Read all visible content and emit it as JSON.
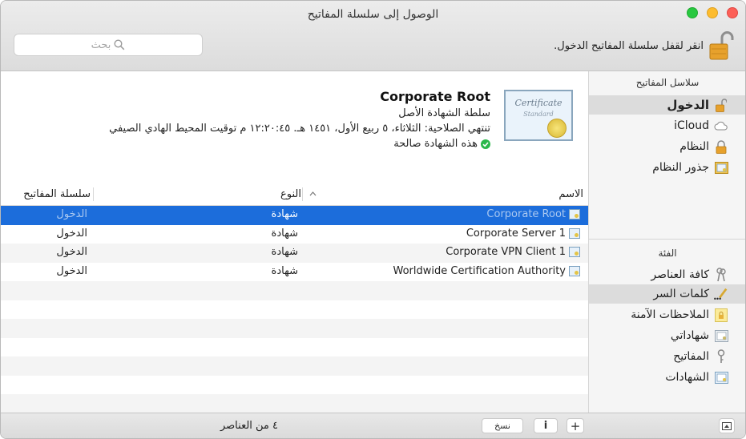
{
  "window": {
    "title": "الوصول إلى سلسلة المفاتيح"
  },
  "toolbar": {
    "search_placeholder": "بحث",
    "lock_text": "انقر لقفل سلسلة المفاتيح الدخول."
  },
  "sidebar": {
    "keychains_header": "سلاسل المفاتيح",
    "keychains": [
      {
        "label": "الدخول",
        "icon": "unlocked-padlock-icon",
        "selected": true
      },
      {
        "label": "iCloud",
        "icon": "cloud-icon"
      },
      {
        "label": "النظام",
        "icon": "locked-padlock-icon"
      },
      {
        "label": "جذور النظام",
        "icon": "certificate-folder-icon"
      }
    ],
    "category_header": "الفئة",
    "categories": [
      {
        "label": "كافة العناصر",
        "icon": "all-items-icon"
      },
      {
        "label": "كلمات السر",
        "icon": "pencil-dots-icon",
        "selected": true
      },
      {
        "label": "الملاحظات الآمنة",
        "icon": "secure-note-icon"
      },
      {
        "label": "شهاداتي",
        "icon": "my-certificate-icon"
      },
      {
        "label": "المفاتيح",
        "icon": "key-icon"
      },
      {
        "label": "الشهادات",
        "icon": "certificate-icon"
      }
    ]
  },
  "detail": {
    "name": "Corporate Root",
    "subtitle": "سلطة الشهادة الأصل",
    "expiry": "تنتهي الصلاحية: الثلاثاء، ٥ ربيع الأول، ١٤٥١ هـ. ١٢:٢٠:٤٥ م توقيت المحيط الهادي الصيفي",
    "status": "هذه الشهادة صالحة",
    "cert_title": "Certificate",
    "cert_sub": "Standard"
  },
  "table": {
    "headers": {
      "name": "الاسم",
      "kind": "النوع",
      "keychain": "سلسلة المفاتيح"
    },
    "rows": [
      {
        "name": "Corporate Root",
        "kind": "شهادة",
        "keychain": "الدخول",
        "selected": true
      },
      {
        "name": "Corporate Server 1",
        "kind": "شهادة",
        "keychain": "الدخول"
      },
      {
        "name": "Corporate VPN Client 1",
        "kind": "شهادة",
        "keychain": "الدخول"
      },
      {
        "name": "Worldwide Certification Authority",
        "kind": "شهادة",
        "keychain": "الدخول"
      }
    ]
  },
  "statusbar": {
    "count": "٤ من العناصر",
    "copy_label": "نسخ",
    "info_label": "i",
    "add_label": "+"
  }
}
